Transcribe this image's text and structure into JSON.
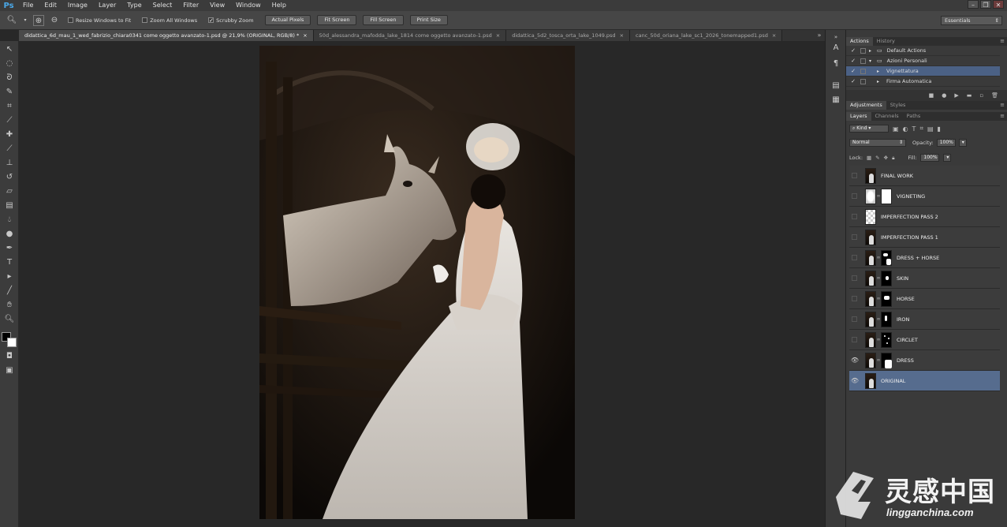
{
  "app": {
    "logo": "Ps"
  },
  "menu": [
    "File",
    "Edit",
    "Image",
    "Layer",
    "Type",
    "Select",
    "Filter",
    "View",
    "Window",
    "Help"
  ],
  "options_bar": {
    "checks": [
      {
        "label": "Resize Windows to Fit",
        "checked": false
      },
      {
        "label": "Zoom All Windows",
        "checked": false
      },
      {
        "label": "Scrubby Zoom",
        "checked": true
      }
    ],
    "buttons": [
      "Actual Pixels",
      "Fit Screen",
      "Fill Screen",
      "Print Size"
    ],
    "workspace": "Essentials"
  },
  "tabs": [
    {
      "label": "didattica_6d_mau_1_wed_fabrizio_chiara0341 come oggetto avanzato-1.psd @ 21,9% (ORIGINAL, RGB/8) *",
      "active": true
    },
    {
      "label": "50d_alessandra_mafodda_lake_1814 come oggetto avanzato-1.psd",
      "active": false
    },
    {
      "label": "didattica_5d2_tosca_orta_lake_1049.psd",
      "active": false
    },
    {
      "label": "canc_50d_oriana_lake_sc1_2026_tonemapped1.psd",
      "active": false
    }
  ],
  "actions_panel": {
    "tabs": [
      "Actions",
      "History"
    ],
    "rows": [
      {
        "label": "Default Actions",
        "indent": 0,
        "type": "set"
      },
      {
        "label": "Azioni Personali",
        "indent": 0,
        "type": "set-open"
      },
      {
        "label": "Vignettatura",
        "indent": 1,
        "type": "action",
        "selected": true
      },
      {
        "label": "Firma Automatica",
        "indent": 1,
        "type": "action"
      }
    ]
  },
  "adjustments_tabs": [
    "Adjustments",
    "Styles"
  ],
  "layers_panel": {
    "tabs": [
      "Layers",
      "Channels",
      "Paths"
    ],
    "kind": "Kind",
    "blend_mode": "Normal",
    "opacity_label": "Opacity:",
    "opacity": "100%",
    "lock_label": "Lock:",
    "fill_label": "Fill:",
    "fill": "100%",
    "layers": [
      {
        "name": "FINAL WORK",
        "thumb": "photo",
        "mask": "none",
        "visible": false
      },
      {
        "name": "VIGNETING",
        "thumb": "vignette",
        "mask": "white",
        "visible": false
      },
      {
        "name": "IMPERFECTION PASS 2",
        "thumb": "checker",
        "mask": "none",
        "visible": false
      },
      {
        "name": "IMPERFECTION PASS 1",
        "thumb": "photo",
        "mask": "none",
        "visible": false
      },
      {
        "name": "DRESS + HORSE",
        "thumb": "photo",
        "mask": "shapes",
        "visible": false
      },
      {
        "name": "SKIN",
        "thumb": "photo",
        "mask": "dot",
        "visible": false
      },
      {
        "name": "HORSE",
        "thumb": "photo",
        "mask": "blob",
        "visible": false
      },
      {
        "name": "IRON",
        "thumb": "photo",
        "mask": "spot",
        "visible": false
      },
      {
        "name": "CIRCLET",
        "thumb": "photo",
        "mask": "dots",
        "visible": false
      },
      {
        "name": "DRESS",
        "thumb": "photo",
        "mask": "dress",
        "visible": true
      },
      {
        "name": "ORIGINAL",
        "thumb": "photo",
        "mask": "none",
        "visible": true,
        "selected": true
      }
    ]
  },
  "watermark": {
    "text": "灵感中国",
    "url": "lingganchina.com"
  }
}
